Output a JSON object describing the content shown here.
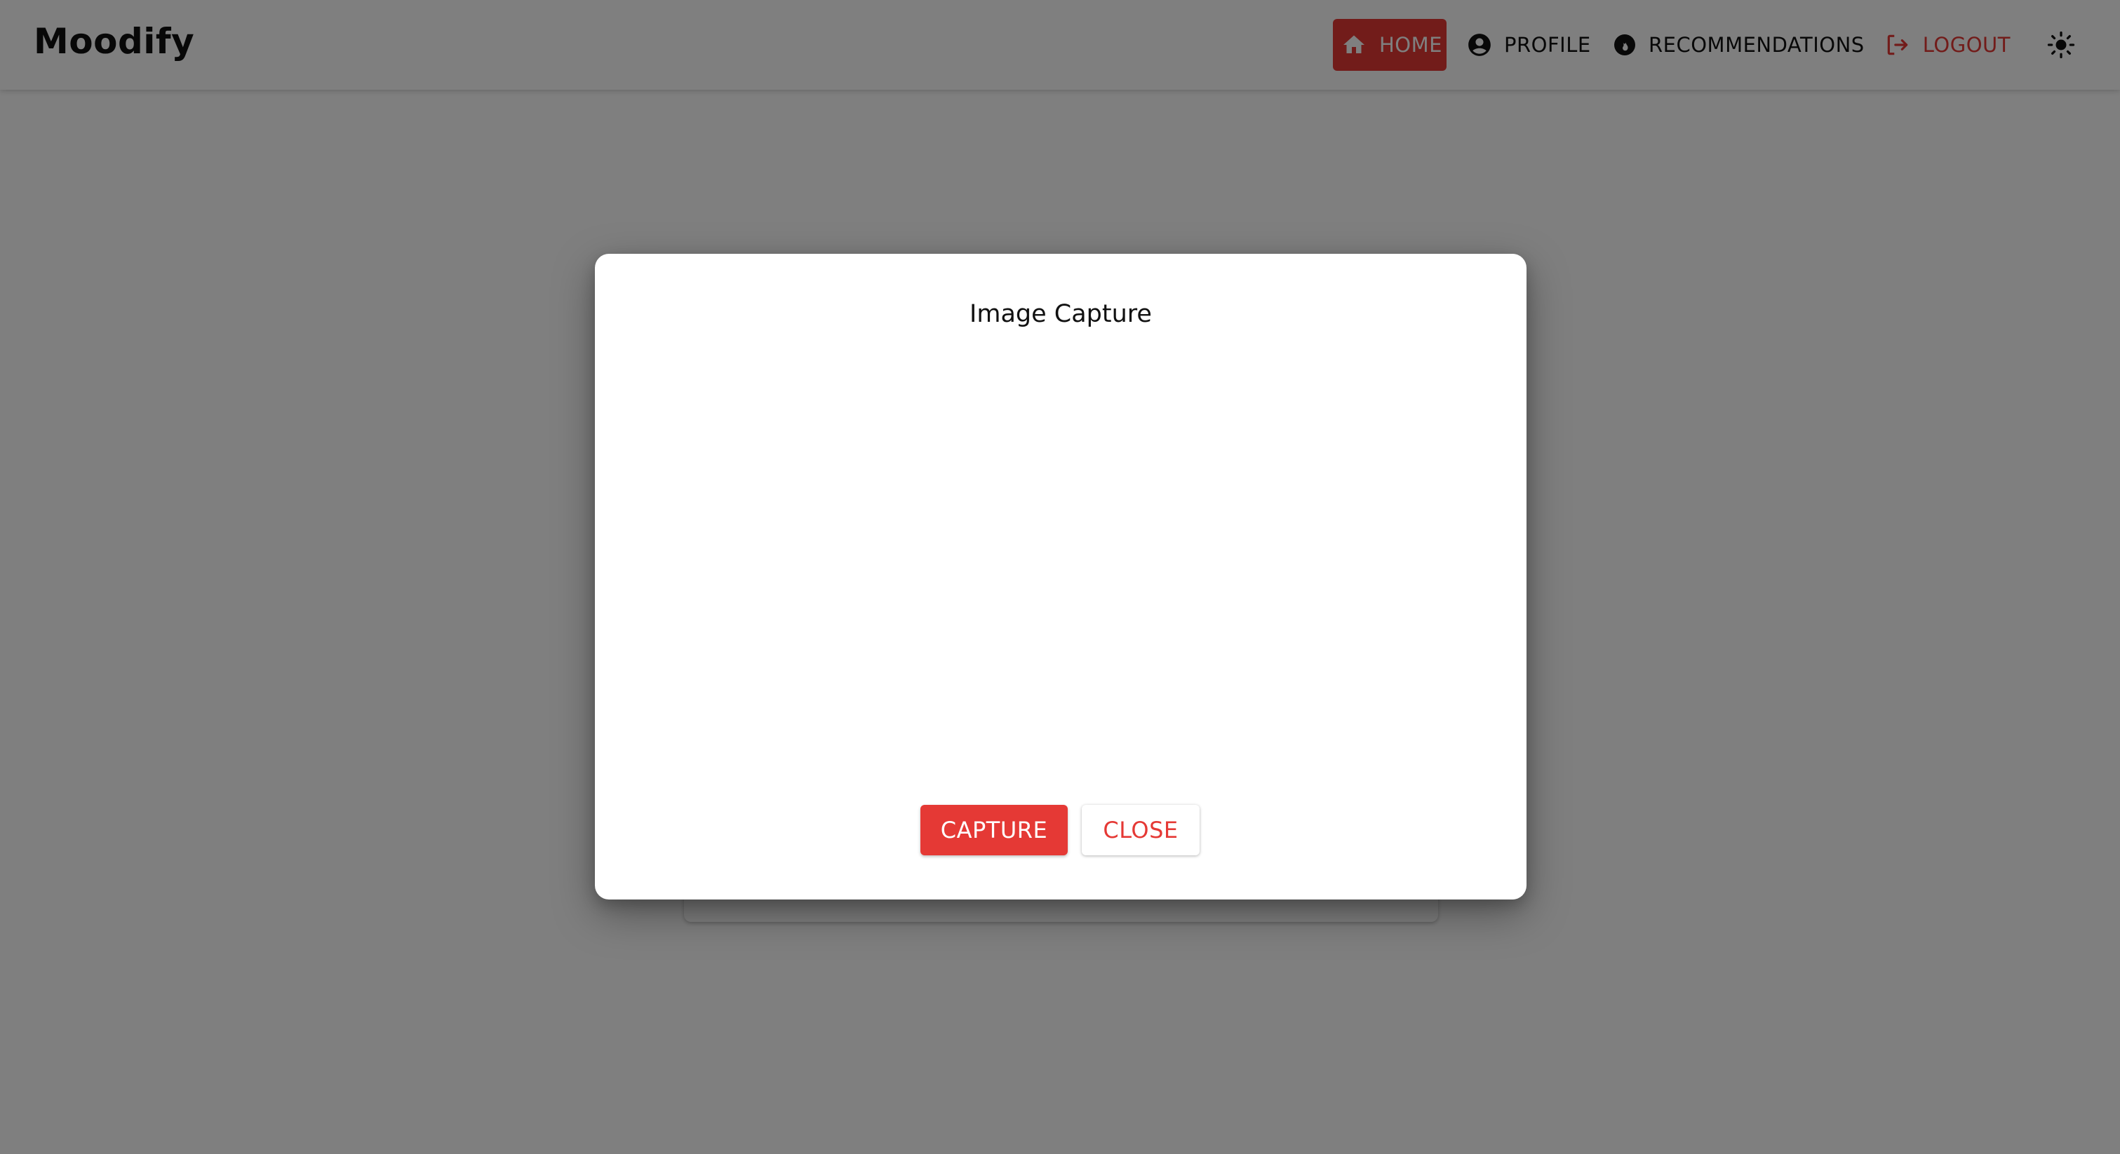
{
  "app": {
    "brand": "Moodify"
  },
  "nav": {
    "home": "HOME",
    "profile": "PROFILE",
    "recommendations": "RECOMMENDATIONS",
    "logout": "LOGOUT"
  },
  "icons": {
    "home": "home-icon",
    "profile": "account-circle-icon",
    "recommendations": "recommendations-icon",
    "logout": "logout-icon",
    "theme": "sun-icon"
  },
  "dialog": {
    "title": "Image Capture",
    "capture_label": "CAPTURE",
    "close_label": "CLOSE"
  },
  "colors": {
    "accent": "#e53935",
    "backdrop": "rgba(0,0,0,0.5)"
  }
}
